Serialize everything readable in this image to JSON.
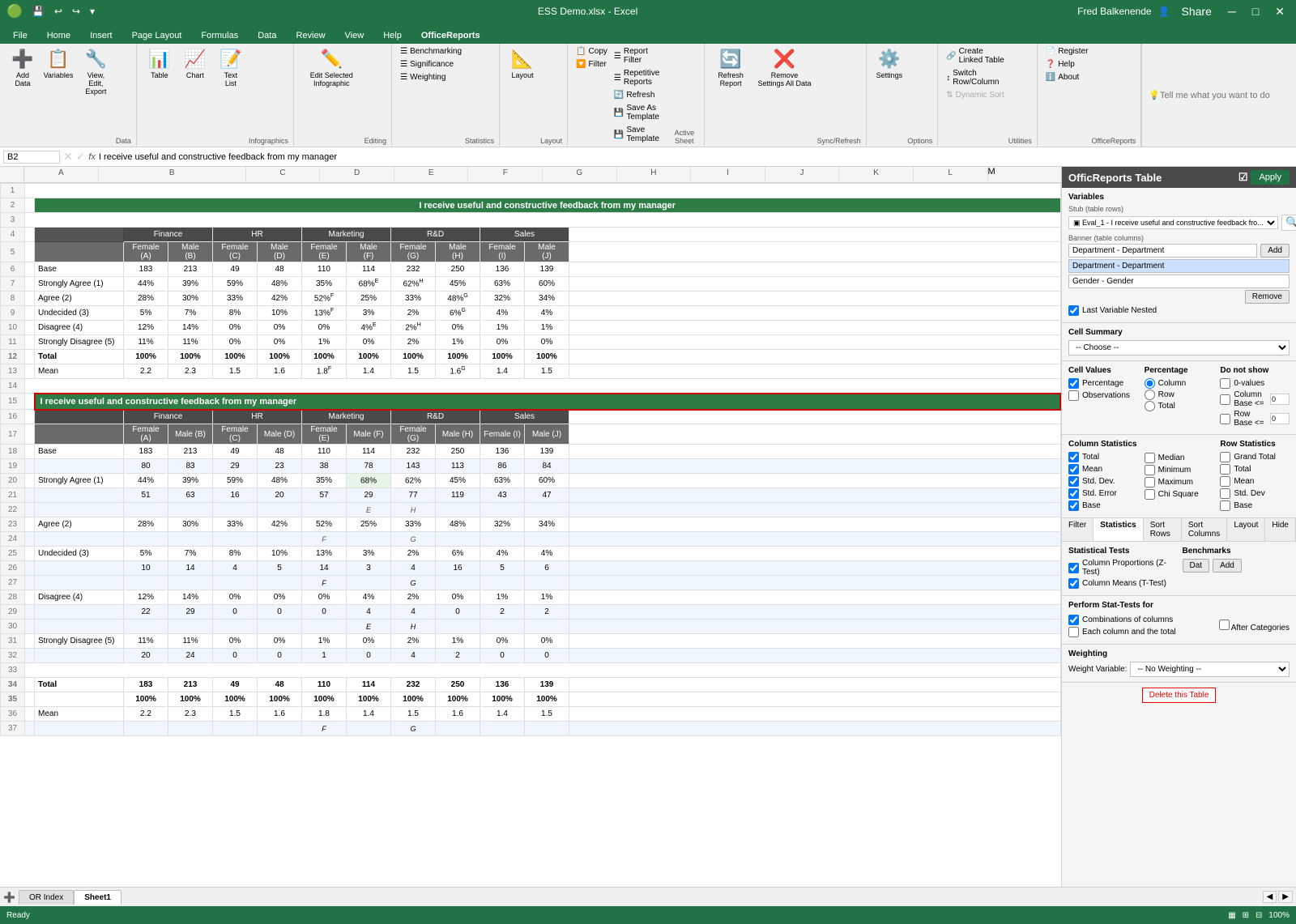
{
  "titleBar": {
    "filename": "ESS Demo.xlsx - Excel",
    "user": "Fred Balkenende",
    "quickAccess": [
      "↩",
      "↪",
      "💾",
      "↑"
    ]
  },
  "ribbonTabs": [
    "File",
    "Home",
    "Insert",
    "Page Layout",
    "Formulas",
    "Data",
    "Review",
    "View",
    "Help",
    "OfficeReports"
  ],
  "activeTab": "OfficeReports",
  "ribbon": {
    "groups": [
      {
        "name": "Data",
        "buttons": [
          {
            "id": "add-data",
            "label": "Add Data",
            "icon": "➕"
          },
          {
            "id": "variables",
            "label": "Variables",
            "icon": "📋"
          },
          {
            "id": "view-edit-export",
            "label": "View, Edit, Export",
            "icon": "🔧"
          }
        ]
      },
      {
        "name": "Infographics",
        "buttons": [
          {
            "id": "table",
            "label": "Table",
            "icon": "📊"
          },
          {
            "id": "chart",
            "label": "Chart",
            "icon": "📈"
          },
          {
            "id": "text-list",
            "label": "Text List",
            "icon": "📝"
          }
        ]
      },
      {
        "name": "Editing",
        "buttons": [
          {
            "id": "edit-selected-infographic",
            "label": "Edit Selected Infographic",
            "icon": "✏️"
          }
        ]
      },
      {
        "name": "Statistics",
        "smallButtons": [
          "Benchmarking",
          "Significance",
          "Weighting"
        ]
      },
      {
        "name": "Layout",
        "buttons": [
          {
            "id": "layout",
            "label": "Layout",
            "icon": "📐"
          }
        ]
      },
      {
        "name": "Active Sheet",
        "smallButtons": [
          {
            "label": "Copy",
            "icon": "📋"
          },
          {
            "label": "Filter",
            "icon": "🔽"
          },
          {
            "label": "Refresh",
            "icon": "🔄"
          },
          {
            "label": "Save As Template",
            "icon": "💾"
          },
          {
            "label": "Save Template",
            "icon": "💾"
          }
        ]
      },
      {
        "name": "Sync/Refresh",
        "buttons": [
          {
            "id": "sync-refresh",
            "label": "Refresh Report",
            "icon": "🔄"
          },
          {
            "id": "remove-settings",
            "label": "Remove Settings All Data",
            "icon": "❌"
          }
        ]
      },
      {
        "name": "Options",
        "buttons": [
          {
            "id": "settings",
            "label": "Settings",
            "icon": "⚙️"
          }
        ]
      },
      {
        "name": "Utilities",
        "smallButtons": [
          {
            "label": "Create Linked Table"
          },
          {
            "label": "Switch Row/Column"
          },
          {
            "label": "Dynamic Sort"
          }
        ]
      },
      {
        "name": "OfficeReports",
        "smallButtons": [
          {
            "label": "Register"
          },
          {
            "label": "Help"
          },
          {
            "label": "About"
          }
        ]
      }
    ]
  },
  "formulaBar": {
    "cellRef": "B2",
    "formula": "I receive useful and constructive feedback from my manager"
  },
  "tellMe": "Tell me what you want to do",
  "spreadsheet": {
    "colHeaders": [
      "A",
      "B",
      "C",
      "D",
      "E",
      "F",
      "G",
      "H",
      "I",
      "J",
      "K",
      "L",
      "M"
    ],
    "rowNumbers": [
      1,
      2,
      3,
      4,
      5,
      6,
      7,
      8,
      9,
      10,
      11,
      12,
      13,
      14,
      15,
      16,
      17,
      18,
      19,
      20,
      21,
      22,
      23,
      24,
      25,
      26,
      27,
      28,
      29,
      30,
      31,
      32,
      33,
      34,
      35,
      36,
      37
    ],
    "table1": {
      "title": "I receive useful and constructive feedback from my manager",
      "deptHeaders": [
        "Finance",
        "HR",
        "Marketing",
        "R&D",
        "Sales"
      ],
      "subHeaders": [
        {
          "label": "Female (A)"
        },
        {
          "label": "Male (B)"
        },
        {
          "label": "Female (C)"
        },
        {
          "label": "Male (D)"
        },
        {
          "label": "Female (E)"
        },
        {
          "label": "Male (F)"
        },
        {
          "label": "Female (G)"
        },
        {
          "label": "Male (H)"
        },
        {
          "label": "Female (I)"
        },
        {
          "label": "Male (J)"
        }
      ],
      "rows": [
        {
          "label": "Base",
          "vals": [
            "183",
            "213",
            "49",
            "48",
            "110",
            "114",
            "232",
            "250",
            "136",
            "139"
          ]
        },
        {
          "label": "Strongly Agree (1)",
          "vals": [
            "44%",
            "39%",
            "59%",
            "48%",
            "35%",
            "68%E",
            "62%H",
            "45%",
            "63%",
            "60%"
          ]
        },
        {
          "label": "Agree (2)",
          "vals": [
            "28%",
            "30%",
            "33%",
            "42%",
            "52%F",
            "25%",
            "33%",
            "48%G",
            "32%",
            "34%"
          ]
        },
        {
          "label": "Undecided (3)",
          "vals": [
            "5%",
            "7%",
            "8%",
            "10%",
            "13%F",
            "3%",
            "2%",
            "6%G",
            "4%",
            "4%"
          ]
        },
        {
          "label": "Disagree (4)",
          "vals": [
            "12%",
            "14%",
            "0%",
            "0%",
            "0%",
            "4%E",
            "2%H",
            "0%",
            "1%",
            "1%"
          ]
        },
        {
          "label": "Strongly Disagree (5)",
          "vals": [
            "11%",
            "11%",
            "0%",
            "0%",
            "1%",
            "0%",
            "2%",
            "1%",
            "0%",
            "0%"
          ]
        },
        {
          "label": "Total",
          "vals": [
            "100%",
            "100%",
            "100%",
            "100%",
            "100%",
            "100%",
            "100%",
            "100%",
            "100%",
            "100%"
          ]
        },
        {
          "label": "Mean",
          "vals": [
            "2.2",
            "2.3",
            "1.5",
            "1.6",
            "1.8F",
            "1.4",
            "1.5",
            "1.6G",
            "1.4",
            "1.5"
          ]
        }
      ]
    },
    "table2": {
      "title": "I receive useful and constructive feedback from my manager",
      "deptHeaders": [
        "Finance",
        "HR",
        "Marketing",
        "R&D",
        "Sales"
      ],
      "subHeaders": [
        {
          "label": "Female (A)"
        },
        {
          "label": "Male (B)"
        },
        {
          "label": "Female (C)"
        },
        {
          "label": "Male (D)"
        },
        {
          "label": "Female (E)"
        },
        {
          "label": "Male (F)"
        },
        {
          "label": "Female (G)"
        },
        {
          "label": "Male (H)"
        },
        {
          "label": "Female (I)"
        },
        {
          "label": "Male (J)"
        }
      ],
      "rows": [
        {
          "label": "Base",
          "vals": [
            "183",
            "213",
            "49",
            "48",
            "110",
            "114",
            "232",
            "250",
            "136",
            "139"
          ],
          "sub": [
            "80",
            "83",
            "29",
            "23",
            "38",
            "78",
            "143",
            "113",
            "86",
            "84"
          ]
        },
        {
          "label": "Strongly Agree (1)",
          "vals": [
            "44%",
            "39%",
            "59%",
            "48%",
            "35%",
            "68%",
            "62%",
            "45%",
            "63%",
            "60%"
          ],
          "sub": [
            "51",
            "63",
            "16",
            "20",
            "57",
            "29",
            "77",
            "119",
            "43",
            "47"
          ],
          "flags": [
            "",
            "",
            "",
            "",
            "",
            "E",
            "H",
            "",
            "",
            ""
          ]
        },
        {
          "label": "Agree (2)",
          "vals": [
            "28%",
            "30%",
            "33%",
            "42%",
            "52%",
            "25%",
            "33%",
            "48%",
            "32%",
            "34%"
          ],
          "sub": [
            "",
            "",
            "",
            "",
            "",
            "F",
            "G",
            "",
            "",
            ""
          ]
        },
        {
          "label": "Undecided (3)",
          "vals": [
            "5%",
            "7%",
            "8%",
            "10%",
            "13%",
            "3%",
            "2%",
            "6%",
            "4%",
            "4%"
          ],
          "sub": [
            "10",
            "14",
            "4",
            "5",
            "14",
            "3",
            "4",
            "16",
            "5",
            "6"
          ]
        },
        {
          "label": "Disagree (4)",
          "vals": [
            "12%",
            "14%",
            "0%",
            "0%",
            "0%",
            "4%",
            "2%",
            "0%",
            "1%",
            "1%"
          ],
          "sub": [
            "22",
            "29",
            "0",
            "0",
            "0",
            "4",
            "4",
            "0",
            "2",
            "2"
          ]
        },
        {
          "label": "Strongly Disagree (5)",
          "vals": [
            "11%",
            "11%",
            "0%",
            "0%",
            "1%",
            "0%",
            "2%",
            "1%",
            "0%",
            "0%"
          ],
          "sub": [
            "20",
            "24",
            "0",
            "0",
            "1",
            "0",
            "4",
            "2",
            "0",
            "0"
          ]
        },
        {
          "label": "Total",
          "vals": [
            "183",
            "213",
            "49",
            "48",
            "110",
            "114",
            "232",
            "250",
            "136",
            "139"
          ],
          "pcts": [
            "100%",
            "100%",
            "100%",
            "100%",
            "100%",
            "100%",
            "100%",
            "100%",
            "100%",
            "100%"
          ]
        },
        {
          "label": "Mean",
          "vals": [
            "2.2",
            "2.3",
            "1.5",
            "1.6",
            "1.8",
            "1.4",
            "1.5",
            "1.6",
            "1.4",
            "1.5"
          ],
          "flags": [
            "",
            "",
            "",
            "",
            "F",
            "",
            "G",
            ""
          ]
        }
      ]
    }
  },
  "rightPanel": {
    "title": "OfficReports Table",
    "applyBtn": "Apply",
    "variables": {
      "title": "Variables",
      "stubLabel": "Stub (table rows)",
      "stubValue": "Eval_1 - I receive useful and constructive feedback fro...",
      "bannerLabel": "Banner (table columns)",
      "bannerItems": [
        "Department - Department",
        "Gender - Gender"
      ],
      "addBtn": "Add",
      "removeBtn": "Remove",
      "lastVariableNested": true,
      "lastVariableNestedLabel": "Last Variable Nested"
    },
    "cellSummary": {
      "title": "Cell Summary",
      "option": "-- Choose --"
    },
    "cellValues": {
      "title": "Cell Values",
      "percentage": true,
      "observations": false
    },
    "percentage": {
      "title": "Percentage",
      "column": true,
      "row": false,
      "total": false
    },
    "doNotShow": {
      "title": "Do not show",
      "zeroValues": false,
      "columnBase": false,
      "columnBaseVal": "0",
      "rowBase": false,
      "rowBaseVal": "0"
    },
    "columnStatistics": {
      "title": "Column Statistics",
      "total": true,
      "mean": true,
      "stdDev": true,
      "stdError": true,
      "base": true,
      "median": false,
      "minimum": false,
      "maximum": false,
      "chiSquare": false
    },
    "rowStatistics": {
      "title": "Row Statistics",
      "grandTotal": false,
      "total": false,
      "mean": false,
      "stdDev": false,
      "base": false
    },
    "filterTabs": [
      "Filter",
      "Statistics",
      "Sort Rows",
      "Sort Columns",
      "Layout",
      "Hide"
    ],
    "activeFilterTab": "Statistics",
    "statisticalTests": {
      "title": "Statistical Tests",
      "columnProportions": true,
      "columnMeans": true,
      "columnProportionsLabel": "Column Proportions (Z-Test)",
      "columnMeansLabel": "Column Means (T-Test)"
    },
    "performStatFor": {
      "title": "Perform Stat-Tests for",
      "combinations": true,
      "eachAndTotal": false,
      "combinationsLabel": "Combinations of columns",
      "eachLabel": "Each column and the total",
      "afterCategories": false
    },
    "benchmarks": {
      "title": "Benchmarks",
      "dat": "Dat",
      "add": "Add"
    },
    "weighting": {
      "title": "Weighting",
      "weightVariable": "Weight Variable:",
      "noWeighting": "-- No Weighting --"
    },
    "deleteBtn": "Delete this Table"
  },
  "sheetTabs": [
    "OR Index",
    "Sheet1"
  ],
  "activeSheet": "Sheet1",
  "statusBar": {
    "status": "Ready",
    "zoom": "100%"
  }
}
